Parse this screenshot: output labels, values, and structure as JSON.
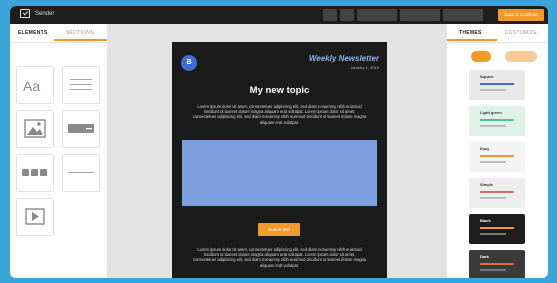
{
  "app": {
    "name": "Sender",
    "save_label": "Save & Continue"
  },
  "left_panel": {
    "tabs": [
      "ELEMENTS",
      "SECTIONS"
    ],
    "active_tab": "ELEMENTS",
    "text_block_label": "Aa"
  },
  "newsletter": {
    "logo_letter": "B",
    "title": "Weekly Newsletter",
    "date": "January 1, 2019",
    "topic": "My new topic",
    "paragraph1": "Lorem ipsum dolor sit amet, consectetuer adipiscing elit, sed diam nonummy nibh euismod tincidunt ut laoreet dolore magna aliquam erat volutpat. Lorem ipsum dolor sit amet, consectetuer adipiscing elit, sed diam nonummy nibh euismod tincidunt ut laoreet dolore magna aliquam erat volutpat.",
    "paragraph2": "Lorem ipsum dolor sit amet, consectetuer adipiscing elit, sed diam nonummy nibh euismod tincidunt ut laoreet dolore magna aliquam erat volutpat. Lorem ipsum dolor sit amet, consectetuer adipiscing elit, sed diam nonummy nibh euismod tincidunt ut laoreet dolore magna aliquam erat volutpat.",
    "button_text": "Button text"
  },
  "right_panel": {
    "tabs": [
      "THEMES",
      "CUSTOMIZE"
    ],
    "active_tab": "THEMES",
    "themes": [
      {
        "name": "Square",
        "bg": "#e9e9e9",
        "accent": "#3e6fd0"
      },
      {
        "name": "Light green",
        "bg": "#dff2ea",
        "accent": "#4fbf8f"
      },
      {
        "name": "Easy",
        "bg": "#f4f4f4",
        "accent": "#f19a2a"
      },
      {
        "name": "Simple",
        "bg": "#eeeeee",
        "accent": "#d46a6a"
      },
      {
        "name": "Black",
        "bg": "#1e1e1e",
        "accent": "#f19a2a"
      },
      {
        "name": "Dark",
        "bg": "#3a3a3a",
        "accent": "#e46a3c"
      }
    ]
  },
  "colors": {
    "accent": "#f19a2a",
    "frame": "#3aa6d8",
    "hero": "#7c9fde"
  }
}
